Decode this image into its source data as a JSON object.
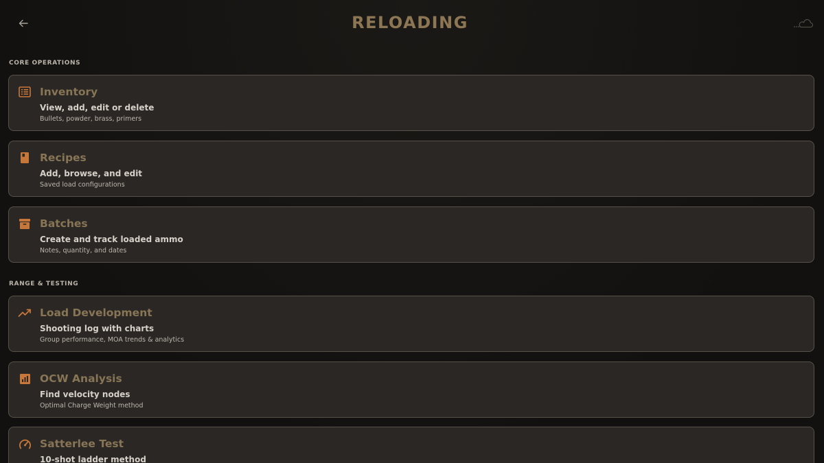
{
  "header": {
    "title": "RELOADING",
    "back_icon": "arrow-left-icon",
    "sync_icon": "cloud-sync-icon"
  },
  "colors": {
    "accent": "#c8773a",
    "title": "#8c7654",
    "card_bg": "#2a2724",
    "card_border": "#57514a"
  },
  "sections": [
    {
      "label": "CORE OPERATIONS",
      "cards": [
        {
          "icon": "list-alt-icon",
          "title": "Inventory",
          "subtitle": "View, add, edit or delete",
          "description": "Bullets, powder, brass, primers"
        },
        {
          "icon": "book-icon",
          "title": "Recipes",
          "subtitle": "Add, browse, and edit",
          "description": "Saved load configurations"
        },
        {
          "icon": "archive-box-icon",
          "title": "Batches",
          "subtitle": "Create and track loaded ammo",
          "description": "Notes, quantity, and dates"
        }
      ]
    },
    {
      "label": "RANGE & TESTING",
      "cards": [
        {
          "icon": "trend-line-icon",
          "title": "Load Development",
          "subtitle": "Shooting log with charts",
          "description": "Group performance, MOA trends & analytics"
        },
        {
          "icon": "bar-chart-icon",
          "title": "OCW Analysis",
          "subtitle": "Find velocity nodes",
          "description": "Optimal Charge Weight method"
        },
        {
          "icon": "speedometer-icon",
          "title": "Satterlee Test",
          "subtitle": "10-shot ladder method",
          "description": ""
        }
      ]
    }
  ]
}
